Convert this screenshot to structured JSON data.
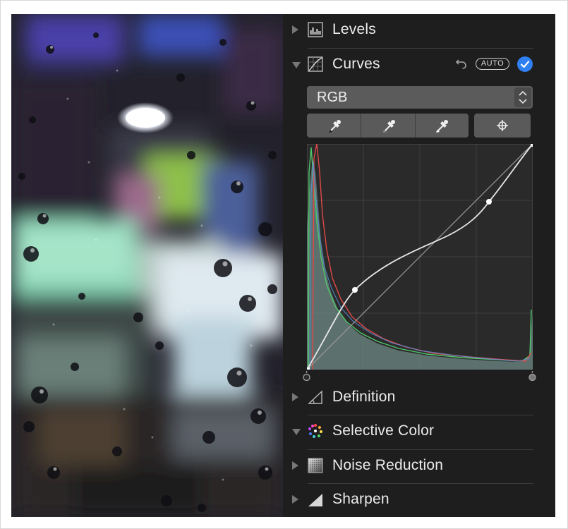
{
  "panel": {
    "sections": {
      "levels": {
        "label": "Levels",
        "icon": "levels-icon",
        "expanded": false
      },
      "curves": {
        "label": "Curves",
        "icon": "curves-icon",
        "expanded": true
      },
      "definition": {
        "label": "Definition",
        "icon": "definition-icon",
        "expanded": false
      },
      "selective_color": {
        "label": "Selective Color",
        "icon": "selective-color-icon",
        "expanded": true
      },
      "noise_reduction": {
        "label": "Noise Reduction",
        "icon": "noise-reduction-icon",
        "expanded": false
      },
      "sharpen": {
        "label": "Sharpen",
        "icon": "sharpen-icon",
        "expanded": false
      }
    },
    "curves": {
      "auto_label": "AUTO",
      "channel": "RGB",
      "enabled": true,
      "accent_color": "#2f7ff0",
      "control_points": [
        [
          0,
          0
        ],
        [
          0.21,
          0.34
        ],
        [
          0.81,
          0.74
        ],
        [
          1,
          1
        ]
      ]
    }
  }
}
